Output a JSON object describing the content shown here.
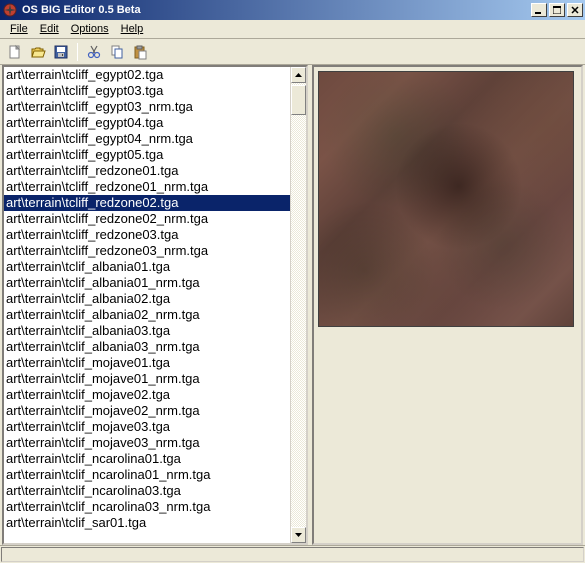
{
  "window": {
    "title": "OS BIG Editor 0.5 Beta"
  },
  "menus": {
    "file": "File",
    "edit": "Edit",
    "options": "Options",
    "help": "Help"
  },
  "toolbar": {
    "new": "new-file-icon",
    "open": "open-folder-icon",
    "save": "save-disk-icon",
    "cut": "cut-icon",
    "copy": "copy-icon",
    "paste": "paste-icon"
  },
  "filelist": {
    "selectedIndex": 7,
    "items": [
      "art\\terrain\\tcliff_egypt02.tga",
      "art\\terrain\\tcliff_egypt03.tga",
      "art\\terrain\\tcliff_egypt03_nrm.tga",
      "art\\terrain\\tcliff_egypt04.tga",
      "art\\terrain\\tcliff_egypt04_nrm.tga",
      "art\\terrain\\tcliff_egypt05.tga",
      "art\\terrain\\tcliff_redzone01.tga",
      "art\\terrain\\tcliff_redzone01_nrm.tga",
      "art\\terrain\\tcliff_redzone02.tga",
      "art\\terrain\\tcliff_redzone02_nrm.tga",
      "art\\terrain\\tcliff_redzone03.tga",
      "art\\terrain\\tcliff_redzone03_nrm.tga",
      "art\\terrain\\tclif_albania01.tga",
      "art\\terrain\\tclif_albania01_nrm.tga",
      "art\\terrain\\tclif_albania02.tga",
      "art\\terrain\\tclif_albania02_nrm.tga",
      "art\\terrain\\tclif_albania03.tga",
      "art\\terrain\\tclif_albania03_nrm.tga",
      "art\\terrain\\tclif_mojave01.tga",
      "art\\terrain\\tclif_mojave01_nrm.tga",
      "art\\terrain\\tclif_mojave02.tga",
      "art\\terrain\\tclif_mojave02_nrm.tga",
      "art\\terrain\\tclif_mojave03.tga",
      "art\\terrain\\tclif_mojave03_nrm.tga",
      "art\\terrain\\tclif_ncarolina01.tga",
      "art\\terrain\\tclif_ncarolina01_nrm.tga",
      "art\\terrain\\tclif_ncarolina03.tga",
      "art\\terrain\\tclif_ncarolina03_nrm.tga",
      "art\\terrain\\tclif_sar01.tga"
    ]
  }
}
